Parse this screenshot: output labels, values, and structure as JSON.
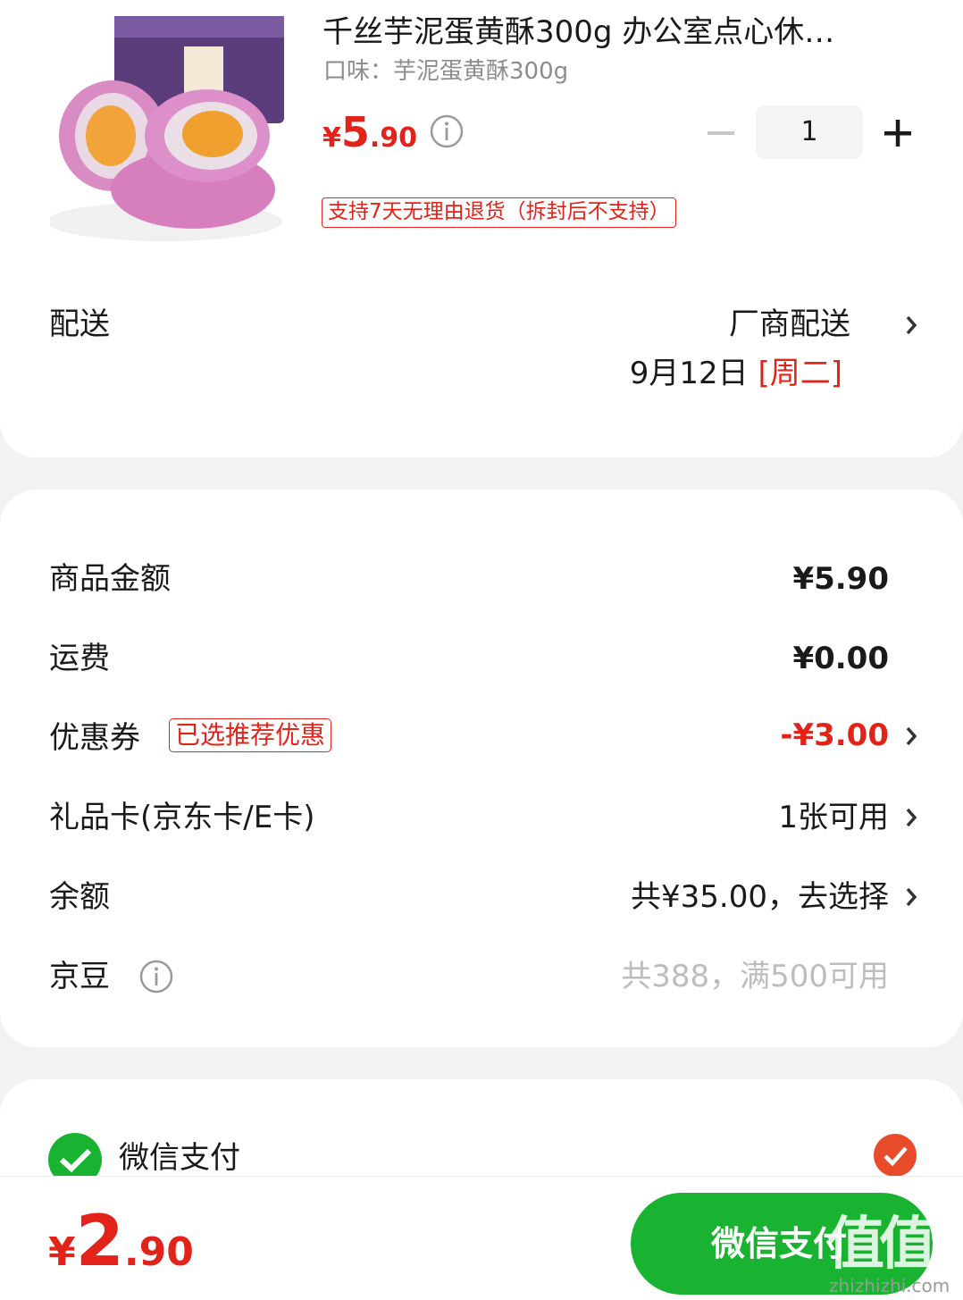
{
  "product": {
    "title": "千丝芋泥蛋黄酥300g 办公室点心休…",
    "spec": "口味：芋泥蛋黄酥300g",
    "price_currency": "¥",
    "price_int": "5",
    "price_dec": ".90",
    "quantity": "1",
    "return_policy": "支持7天无理由退货（拆封后不支持）"
  },
  "delivery": {
    "label": "配送",
    "method": "厂商配送",
    "date": "9月12日",
    "weekday": "[周二]"
  },
  "prices": {
    "goods_label": "商品金额",
    "goods_value": "¥5.90",
    "shipping_label": "运费",
    "shipping_value": "¥0.00",
    "coupon_label": "优惠券",
    "coupon_tag": "已选推荐优惠",
    "coupon_value": "-¥3.00",
    "giftcard_label": "礼品卡(京东卡/E卡)",
    "giftcard_value": "1张可用",
    "balance_label": "余额",
    "balance_value": "共¥35.00，去选择",
    "jingdou_label": "京豆",
    "jingdou_value": "共388，满500可用"
  },
  "payment": {
    "method_label": "微信支付",
    "total_currency": "¥",
    "total_int": "2",
    "total_dec": ".90",
    "pay_button": "微信支付",
    "watermark": "值值值",
    "watermark_url": "zhizhizhi.com"
  },
  "colors": {
    "accent_red": "#e2231a",
    "wechat_green": "#19b331",
    "background": "#f2f2f2"
  },
  "icons": [
    "info-icon",
    "minus-icon",
    "plus-icon",
    "chevron-right-icon",
    "wechat-pay-icon",
    "check-icon"
  ]
}
